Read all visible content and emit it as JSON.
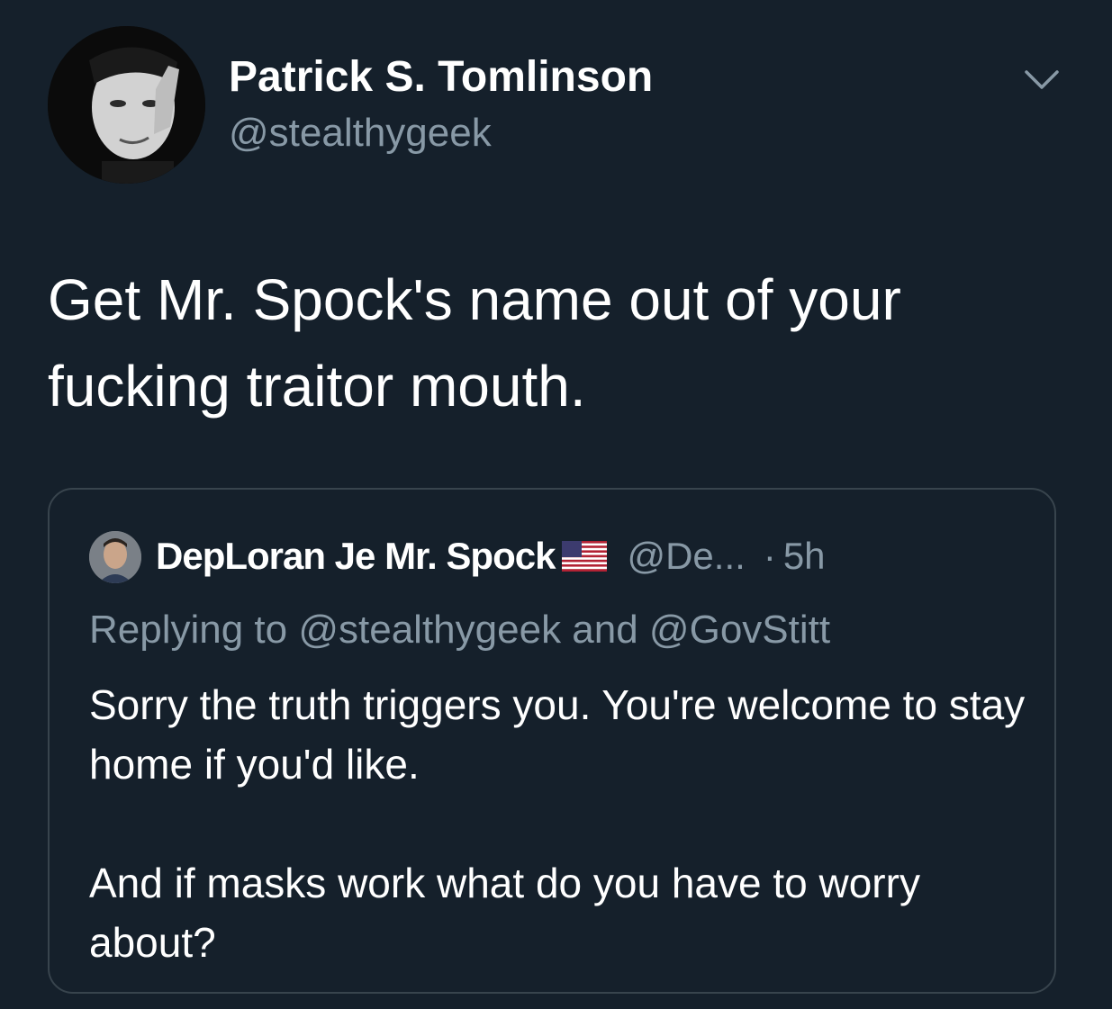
{
  "author": {
    "display_name": "Patrick S. Tomlinson",
    "handle": "@stealthygeek",
    "avatar_icon": "profile-photo"
  },
  "tweet": {
    "text": "Get Mr. Spock's name out of your fucking traitor mouth."
  },
  "menu": {
    "icon": "chevron-down-icon"
  },
  "quoted_tweet": {
    "display_name": "DepLoran Je Mr. Spock",
    "flag_icon": "us-flag-emoji",
    "handle": "@De...",
    "separator": "·",
    "time": "5h",
    "replying_to": "Replying to @stealthygeek and @GovStitt",
    "text_paragraph_1": "Sorry the truth triggers you. You're welcome to stay home if you'd like.",
    "text_paragraph_2": "And if masks work what do you have to worry about?"
  },
  "colors": {
    "background": "#15202b",
    "text": "#ffffff",
    "secondary_text": "#8899a6",
    "border": "#38444d"
  }
}
